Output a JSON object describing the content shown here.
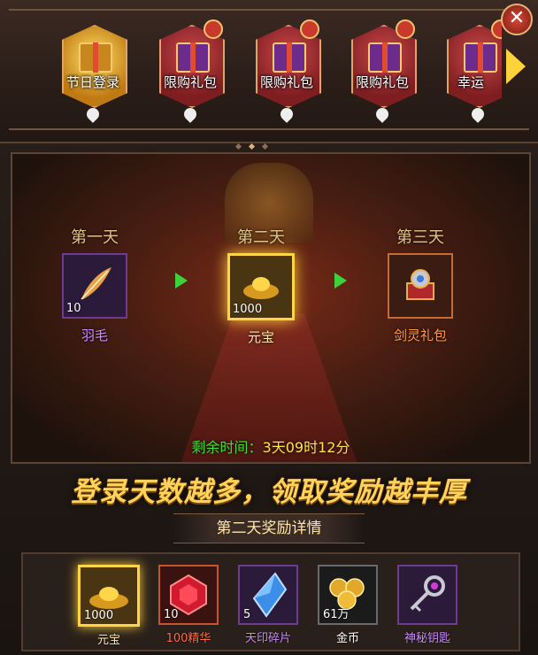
{
  "tabs": [
    {
      "label": "节日登录",
      "active": true
    },
    {
      "label": "限购礼包",
      "active": false
    },
    {
      "label": "限购礼包",
      "active": false
    },
    {
      "label": "限购礼包",
      "active": false
    },
    {
      "label": "幸运",
      "active": false
    }
  ],
  "close_icon": "✕",
  "days": [
    {
      "title": "第一天",
      "item_qty": "10",
      "item_name": "羽毛",
      "name_color": "#c889ff",
      "frame": "purple"
    },
    {
      "title": "第二天",
      "item_qty": "1000",
      "item_name": "元宝",
      "name_color": "#ffe9b0",
      "frame": "gold"
    },
    {
      "title": "第三天",
      "item_qty": "",
      "item_name": "剑灵礼包",
      "name_color": "#ff9a4a",
      "frame": "orange"
    }
  ],
  "remaining": {
    "label": "剩余时间：",
    "value": "3天09时12分",
    "label_color": "#3be03a",
    "value_color": "#ffe34a"
  },
  "slogan": "登录天数越多，领取奖励越丰厚",
  "detail_title": "第二天奖励详情",
  "rewards": [
    {
      "qty": "1000",
      "name": "元宝",
      "name_color": "#ffe9b0",
      "icon": "gold-ingot-icon"
    },
    {
      "qty": "10",
      "name": "100精华",
      "name_color": "#ff6a4a",
      "icon": "red-gem-icon"
    },
    {
      "qty": "5",
      "name": "天印碎片",
      "name_color": "#c889ff",
      "icon": "blue-crystal-icon"
    },
    {
      "qty": "61万",
      "name": "金币",
      "name_color": "#ffffff",
      "icon": "gold-coins-icon"
    },
    {
      "qty": "",
      "name": "神秘钥匙",
      "name_color": "#c889ff",
      "icon": "mystic-key-icon"
    }
  ]
}
